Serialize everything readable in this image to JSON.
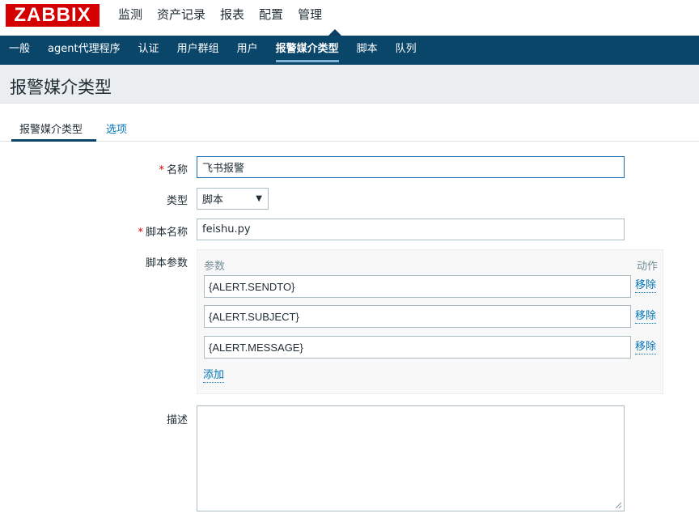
{
  "logo": "ZABBIX",
  "topnav": [
    "监测",
    "资产记录",
    "报表",
    "配置",
    "管理"
  ],
  "subnav": [
    "一般",
    "agent代理程序",
    "认证",
    "用户群组",
    "用户",
    "报警媒介类型",
    "脚本",
    "队列"
  ],
  "page_title": "报警媒介类型",
  "tabs": [
    "报警媒介类型",
    "选项"
  ],
  "form": {
    "name_label": "名称",
    "name_value": "飞书报警",
    "type_label": "类型",
    "type_value": "脚本",
    "script_label": "脚本名称",
    "script_value": "feishu.py",
    "params_label": "脚本参数",
    "params_header": "参数",
    "action_header": "动作",
    "params": [
      "{ALERT.SENDTO}",
      "{ALERT.SUBJECT}",
      "{ALERT.MESSAGE}"
    ],
    "remove_label": "移除",
    "add_label": "添加",
    "desc_label": "描述",
    "desc_value": ""
  }
}
